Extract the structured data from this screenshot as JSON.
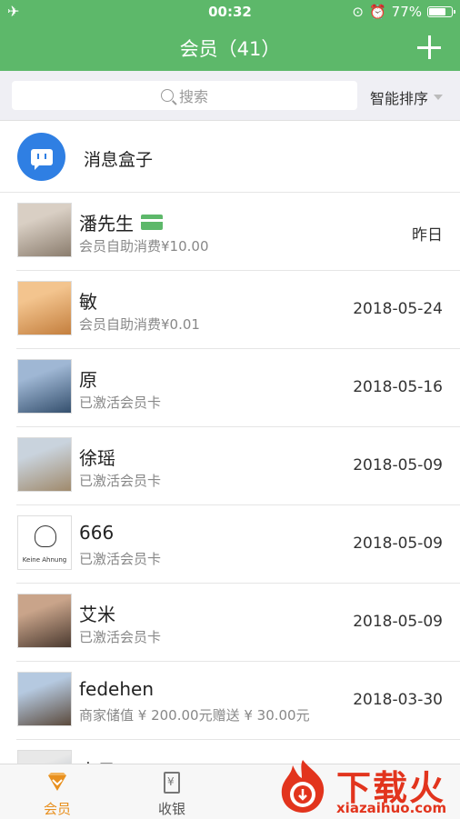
{
  "status_bar": {
    "time": "00:32",
    "battery": "77%",
    "battery_level": 0.77
  },
  "nav": {
    "title": "会员（41）"
  },
  "search": {
    "placeholder": "搜索",
    "sort_label": "智能排序"
  },
  "message_box": {
    "title": "消息盒子"
  },
  "members": [
    {
      "name": "潘先生",
      "subtitle": "会员自助消费¥10.00",
      "date": "昨日",
      "has_card": true,
      "avatar_colors": [
        "#d9cfc4",
        "#8b7d6e"
      ]
    },
    {
      "name": "敏",
      "subtitle": "会员自助消费¥0.01",
      "date": "2018-05-24",
      "avatar_colors": [
        "#f3c48e",
        "#c47f3e"
      ]
    },
    {
      "name": "原",
      "subtitle": "已激活会员卡",
      "date": "2018-05-16",
      "avatar_colors": [
        "#9fb7d4",
        "#35506e"
      ]
    },
    {
      "name": "徐瑶",
      "subtitle": "已激活会员卡",
      "date": "2018-05-09",
      "avatar_colors": [
        "#c9d3dd",
        "#a08a6c"
      ]
    },
    {
      "name": "666",
      "subtitle": "已激活会员卡",
      "date": "2018-05-09",
      "avatar_colors": [
        "#ffffff",
        "#ffffff"
      ],
      "avatar_caption": "Keine Ahnung"
    },
    {
      "name": "艾米",
      "subtitle": "已激活会员卡",
      "date": "2018-05-09",
      "avatar_colors": [
        "#c9a48a",
        "#4b3a30"
      ]
    },
    {
      "name": "fedehen",
      "subtitle": "商家储值 ¥ 200.00元赠送 ¥ 30.00元",
      "date": "2018-03-30",
      "avatar_colors": [
        "#b5c9e0",
        "#5b4a3c"
      ]
    },
    {
      "name": "李日",
      "subtitle": "",
      "date": "",
      "avatar_colors": [
        "#e8e8e8",
        "#9aa6b5"
      ]
    }
  ],
  "tabs": [
    {
      "label": "会员",
      "icon": "diamond-icon",
      "active": true
    },
    {
      "label": "收银",
      "icon": "receipt-icon",
      "active": false
    }
  ],
  "watermark": {
    "text": "下载火",
    "url": "xiazaihuo.com"
  },
  "colors": {
    "brand_green": "#5db86a",
    "active_tab": "#e8901f",
    "message_blue": "#2f7fe3",
    "watermark_red": "#e2341d"
  }
}
